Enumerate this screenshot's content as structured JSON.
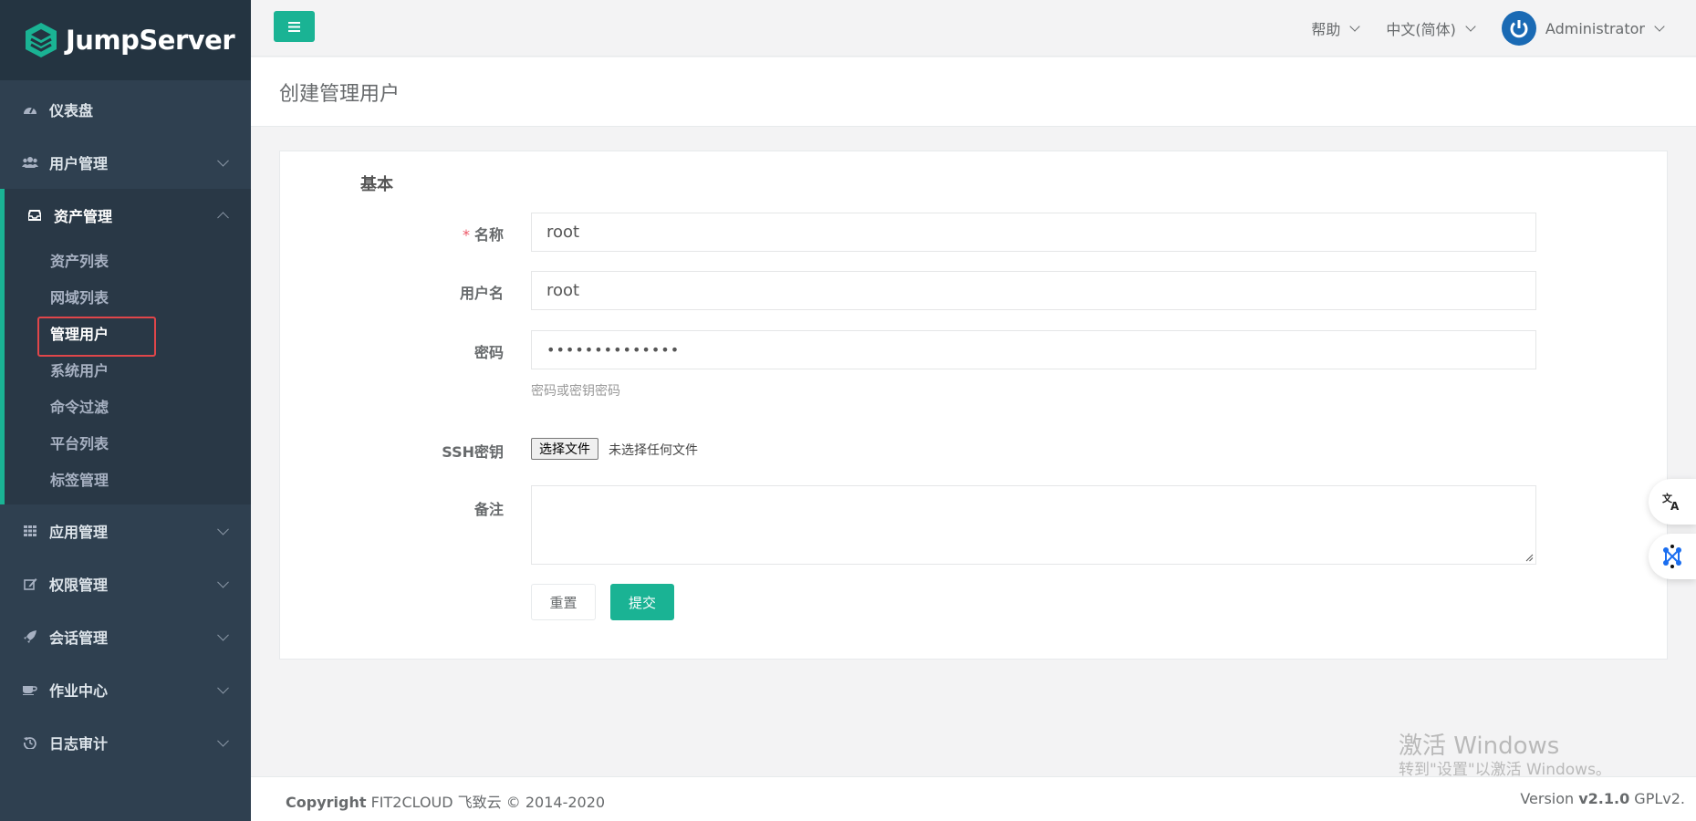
{
  "brand": {
    "name": "JumpServer",
    "accent": "#1ab394"
  },
  "sidebar": {
    "items": [
      {
        "label": "仪表盘",
        "icon": "dashboard-icon"
      },
      {
        "label": "用户管理",
        "icon": "users-icon"
      },
      {
        "label": "资产管理",
        "icon": "inbox-icon",
        "expanded": true,
        "children": [
          {
            "label": "资产列表"
          },
          {
            "label": "网域列表"
          },
          {
            "label": "管理用户",
            "active": true
          },
          {
            "label": "系统用户"
          },
          {
            "label": "命令过滤"
          },
          {
            "label": "平台列表"
          },
          {
            "label": "标签管理"
          }
        ]
      },
      {
        "label": "应用管理",
        "icon": "grid-icon"
      },
      {
        "label": "权限管理",
        "icon": "edit-icon"
      },
      {
        "label": "会话管理",
        "icon": "rocket-icon"
      },
      {
        "label": "作业中心",
        "icon": "coffee-icon"
      },
      {
        "label": "日志审计",
        "icon": "history-icon"
      }
    ]
  },
  "header": {
    "help": "帮助",
    "language": "中文(简体)",
    "user": "Administrator"
  },
  "page": {
    "title": "创建管理用户"
  },
  "form": {
    "section": "基本",
    "name_label": "名称",
    "name_value": "root",
    "username_label": "用户名",
    "username_value": "root",
    "password_label": "密码",
    "password_value": "••••••••••••••",
    "password_help": "密码或密钥密码",
    "ssh_label": "SSH密钥",
    "file_button": "选择文件",
    "file_none": "未选择任何文件",
    "comment_label": "备注",
    "reset": "重置",
    "submit": "提交"
  },
  "footer": {
    "copyright_bold": "Copyright",
    "copyright_text": " FIT2CLOUD 飞致云 © 2014-2020",
    "version_prefix": "Version ",
    "version": "v2.1.0",
    "license": " GPLv2."
  },
  "watermark": {
    "line1": "激活 Windows",
    "line2": "转到\"设置\"以激活 Windows。"
  }
}
